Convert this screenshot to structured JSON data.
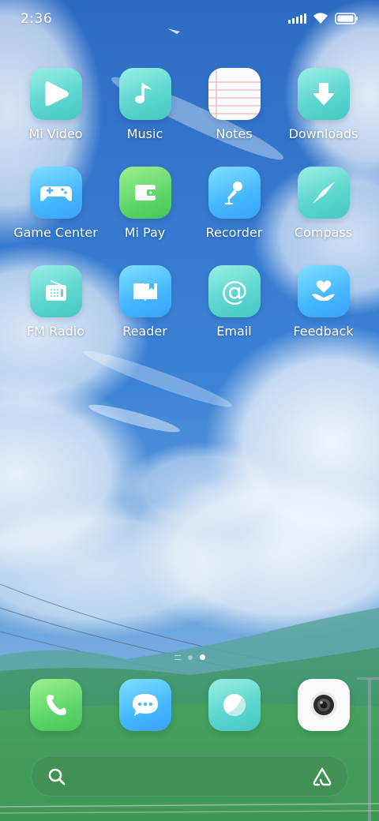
{
  "status_bar": {
    "time": "2:36",
    "icons": [
      "signal-icon",
      "wifi-icon",
      "battery-icon"
    ]
  },
  "home": {
    "rows": [
      [
        {
          "label": "Mi Video",
          "icon": "play-icon"
        },
        {
          "label": "Music",
          "icon": "music-note-icon"
        },
        {
          "label": "Notes",
          "icon": "notepad-icon"
        },
        {
          "label": "Downloads",
          "icon": "download-arrow-icon"
        }
      ],
      [
        {
          "label": "Game Center",
          "icon": "gamepad-icon"
        },
        {
          "label": "Mi Pay",
          "icon": "wallet-icon"
        },
        {
          "label": "Recorder",
          "icon": "microphone-icon"
        },
        {
          "label": "Compass",
          "icon": "compass-icon"
        }
      ],
      [
        {
          "label": "FM Radio",
          "icon": "radio-icon"
        },
        {
          "label": "Reader",
          "icon": "book-icon"
        },
        {
          "label": "Email",
          "icon": "at-sign-icon"
        },
        {
          "label": "Feedback",
          "icon": "heart-hand-icon"
        }
      ]
    ]
  },
  "page_indicator": {
    "pages": 2,
    "active": 2
  },
  "dock": [
    {
      "name": "phone",
      "icon": "phone-icon"
    },
    {
      "name": "messages",
      "icon": "chat-bubble-icon"
    },
    {
      "name": "browser",
      "icon": "browser-icon"
    },
    {
      "name": "camera",
      "icon": "camera-icon"
    }
  ],
  "search_bar": {
    "left_icon": "search-icon",
    "right_icon": "assistant-icon"
  },
  "colors": {
    "sky_blue": "#2f6fc6",
    "teal_icon": "#5ed6cf",
    "blue_icon": "#45b6ff",
    "green_icon": "#5ed66b"
  }
}
